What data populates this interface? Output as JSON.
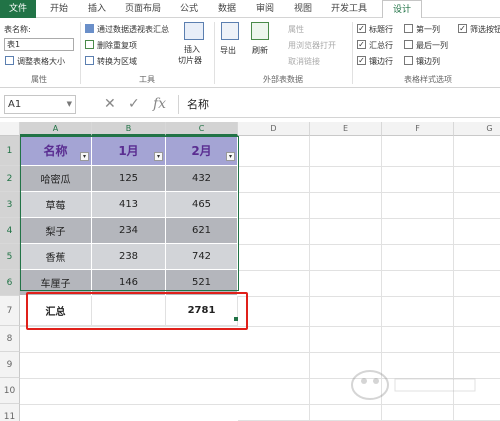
{
  "tabs": [
    "文件",
    "开始",
    "插入",
    "页面布局",
    "公式",
    "数据",
    "审阅",
    "视图",
    "开发工具",
    "设计"
  ],
  "properties": {
    "table_name_label": "表名称:",
    "table_name_value": "表1",
    "resize_label": "调整表格大小",
    "group_label": "属性"
  },
  "tools": {
    "pivot_label": "通过数据透视表汇总",
    "remove_dup_label": "删除重复项",
    "convert_label": "转换为区域",
    "slicer_label_1": "插入",
    "slicer_label_2": "切片器",
    "group_label": "工具"
  },
  "external": {
    "export_label": "导出",
    "refresh_label": "刷新",
    "properties_label": "属性",
    "browser_label": "用浏览器打开",
    "unlink_label": "取消链接",
    "group_label": "外部表数据"
  },
  "style_options": {
    "header_row": "标题行",
    "total_row": "汇总行",
    "banded_rows": "镶边行",
    "first_col": "第一列",
    "last_col": "最后一列",
    "banded_cols": "镶边列",
    "filter_btn": "筛选按钮",
    "group_label": "表格样式选项",
    "check_mark": "✓"
  },
  "formula_bar": {
    "cell_ref": "A1",
    "cancel": "✕",
    "enter": "✓",
    "fx": "fx",
    "content": "名称"
  },
  "columns": [
    "A",
    "B",
    "C",
    "D",
    "E",
    "F",
    "G"
  ],
  "rows": [
    "1",
    "2",
    "3",
    "4",
    "5",
    "6",
    "7",
    "8",
    "9",
    "10",
    "11"
  ],
  "table": {
    "headers": [
      "名称",
      "1月",
      "2月"
    ],
    "filter_glyph": "▾",
    "data": [
      [
        "哈密瓜",
        "125",
        "432"
      ],
      [
        "草莓",
        "413",
        "465"
      ],
      [
        "梨子",
        "234",
        "621"
      ],
      [
        "香蕉",
        "238",
        "742"
      ],
      [
        "车厘子",
        "146",
        "521"
      ]
    ],
    "total": [
      "汇总",
      "",
      "2781"
    ]
  },
  "colors": {
    "accent": "#217346",
    "header_fill": "#a4a4d4",
    "band_dark": "#b4b6bc",
    "band_light": "#d2d4d8",
    "highlight": "#e0201a"
  }
}
